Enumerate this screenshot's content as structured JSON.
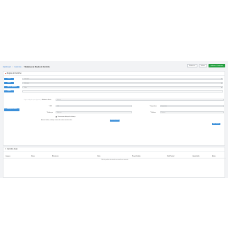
{
  "breadcrumb": {
    "items": [
      "Dashboard",
      "Carrinhos"
    ],
    "current": "Mudança de Moeda do Carrinho"
  },
  "toolbar": {
    "back_label": "Retornar",
    "save_label": "Salvar",
    "save_continue_label": "Salvar e Continuar"
  },
  "panel": {
    "title": "Regras do Carrinho",
    "rows": [
      {
        "label": "Cliente",
        "value": "Selecionar",
        "kind": "select"
      },
      {
        "label": "Moeda",
        "value": "Selecionar",
        "kind": "select"
      },
      {
        "label": "Tipo de Pagamento",
        "value": "Todos",
        "kind": "select"
      },
      {
        "label": "Cupom",
        "placeholder": "Digite o código do cupom (opcional)",
        "kind": "input"
      }
    ],
    "shipping": {
      "method_label": "Método de Envio",
      "method_value": "Nenhum",
      "side_button": "Endereço de Envio",
      "left_fields": [
        {
          "label": "* CEP",
          "placeholder": "CEP"
        },
        {
          "label": "* Endereço",
          "placeholder": "Endereço"
        }
      ],
      "right_fields": [
        {
          "label": "* Seguradora",
          "placeholder": "Seguradora"
        },
        {
          "label": "* Telefone",
          "placeholder": "Telefone"
        }
      ],
      "checkbox_label": "Usar mesmo endereço de cobrança",
      "note_text": "Antes de finalizar, verifique os itens do carrinho antes de salvar",
      "note_button": "Adicionar produto",
      "apply_button": "Aplicar Regras"
    }
  },
  "panel2": {
    "title": "Carrinho Atual",
    "columns": [
      "Imagem",
      "Nome",
      "Referência",
      "Valor",
      "Preço Unitário",
      "Total Parcial",
      "Quantidade",
      "Ações"
    ],
    "empty_text": "Não há produtos adicionados ao carrinho no momento"
  },
  "colors": {
    "accent": "#3b8fd9",
    "success": "#28a745",
    "warning": "#f0a144",
    "danger": "#e0533d"
  }
}
